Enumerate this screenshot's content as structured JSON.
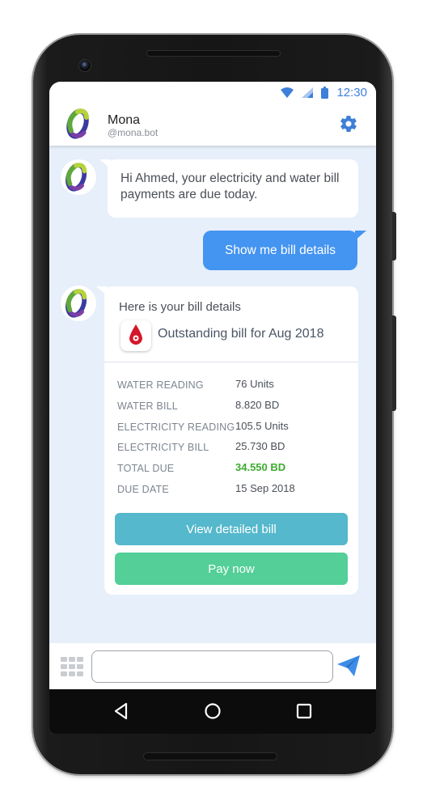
{
  "status_bar": {
    "time": "12:30",
    "icons": [
      "wifi-icon",
      "cellular-signal-icon",
      "battery-icon"
    ]
  },
  "header": {
    "bot_name": "Mona",
    "bot_handle": "@mona.bot",
    "settings_icon": "gear-icon"
  },
  "messages": {
    "bot_greeting": "Hi Ahmed, your electricity and water bill payments are due today.",
    "user_request": "Show me bill details"
  },
  "bill_card": {
    "intro": "Here is your bill details",
    "heading": "Outstanding bill for Aug 2018",
    "icon": "water-drop-icon",
    "rows": [
      {
        "label": "WATER READING",
        "value": "76 Units"
      },
      {
        "label": "WATER BILL",
        "value": "8.820 BD"
      },
      {
        "label": "ELECTRICITY READING",
        "value": "105.5 Units"
      },
      {
        "label": "ELECTRICITY BILL",
        "value": "25.730 BD"
      },
      {
        "label": "TOTAL DUE",
        "value": "34.550 BD"
      },
      {
        "label": "DUE DATE",
        "value": "15 Sep 2018"
      }
    ],
    "view_button": "View detailed bill",
    "pay_button": "Pay now"
  },
  "input_bar": {
    "value": "",
    "placeholder": "",
    "menu_icon": "grid-menu-icon",
    "send_icon": "send-icon"
  },
  "nav_bar": {
    "icons": [
      "back-icon",
      "home-icon",
      "recent-apps-icon"
    ]
  },
  "colors": {
    "accent_blue": "#4494f1",
    "chat_background": "#e6effa",
    "total_due_green": "#3cab2f",
    "view_button": "#55b8cc",
    "pay_button": "#53cf97"
  }
}
